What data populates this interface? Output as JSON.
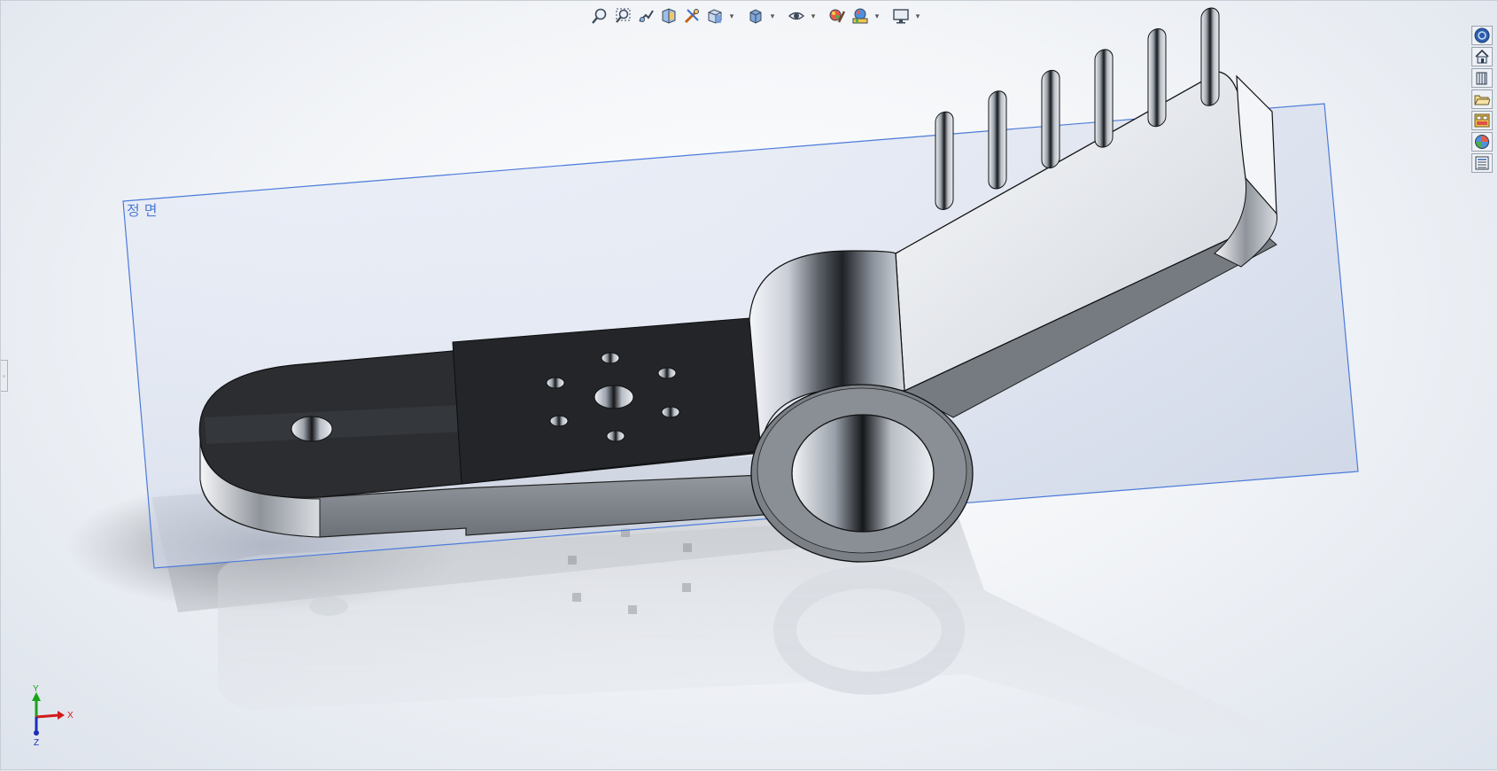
{
  "viewport": {
    "plane_label": "정 면"
  },
  "triad": {
    "y_label": "Y",
    "x_label": "X",
    "z_label": "Z"
  },
  "heads_up_toolbar": {
    "items": [
      {
        "icon": "zoom-to-fit-icon"
      },
      {
        "icon": "zoom-to-area-icon"
      },
      {
        "icon": "previous-view-icon"
      },
      {
        "icon": "section-view-icon"
      },
      {
        "icon": "dynamic-annotation-icon"
      },
      {
        "icon": "view-orientation-icon",
        "dropdown": true
      },
      {
        "icon": "display-style-icon",
        "dropdown": true
      },
      {
        "icon": "hide-show-items-icon",
        "dropdown": true
      },
      {
        "icon": "edit-appearance-icon"
      },
      {
        "icon": "apply-scene-icon",
        "dropdown": true
      },
      {
        "icon": "view-settings-icon",
        "dropdown": true
      }
    ]
  },
  "task_pane": {
    "items": [
      {
        "icon": "solidworks-resources-icon"
      },
      {
        "icon": "home-icon"
      },
      {
        "icon": "design-library-icon"
      },
      {
        "icon": "file-explorer-icon"
      },
      {
        "icon": "view-palette-icon"
      },
      {
        "icon": "appearances-scenes-icon"
      },
      {
        "icon": "custom-properties-icon"
      }
    ]
  },
  "colors": {
    "plane_edge": "#4c7bd9",
    "part_dark": "#2a2c30",
    "part_metal": "#8d9299"
  }
}
